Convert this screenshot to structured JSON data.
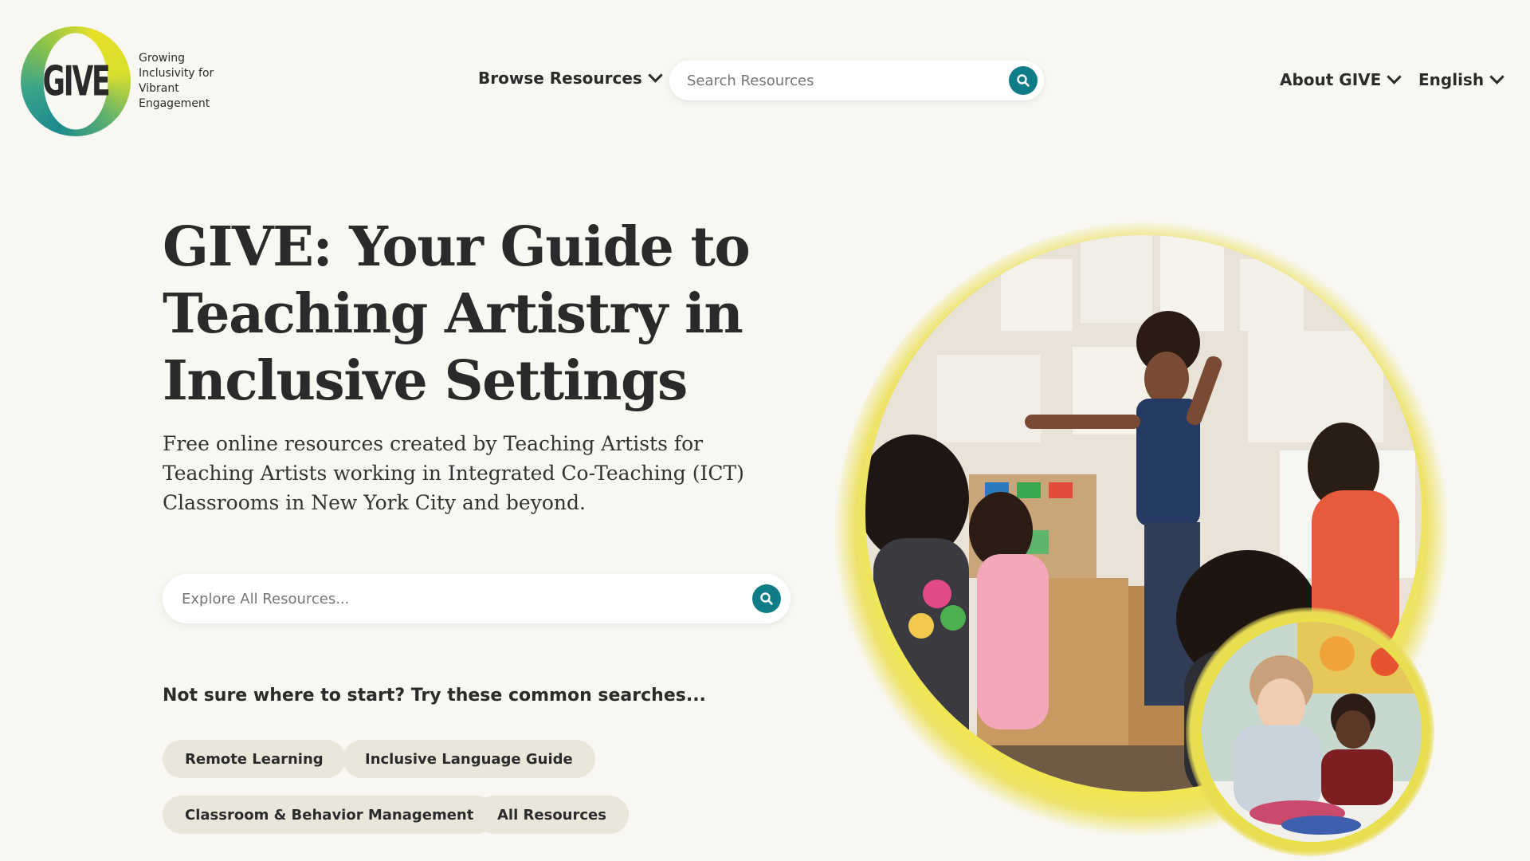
{
  "logo": {
    "wordmark": "GIVE",
    "tagline": [
      "Growing",
      "Inclusivity for",
      "Vibrant",
      "Engagement"
    ]
  },
  "nav": {
    "browse": "Browse Resources",
    "search_placeholder": "Search Resources",
    "about": "About GIVE",
    "language": "English"
  },
  "hero": {
    "title": "GIVE: Your Guide to Teaching Artistry in Inclusive Settings",
    "subtitle": "Free online resources created by Teaching Artists for Teaching Artists working in Integrated Co-Teaching (ICT) Classrooms in New York City and beyond.",
    "search_placeholder": "Explore All Resources..."
  },
  "common_searches": {
    "heading": "Not sure where to start? Try these common searches...",
    "chips": [
      "Remote Learning",
      "Inclusive Language Guide",
      "Classroom & Behavior Management",
      "All Resources"
    ]
  },
  "colors": {
    "background": "#f8f7f2",
    "accent_teal": "#0f7d88",
    "accent_yellow": "#f1e84a",
    "chip_bg": "#e9e7d9"
  },
  "icons": {
    "search": "search-icon",
    "dropdown": "chevron-down-icon"
  }
}
